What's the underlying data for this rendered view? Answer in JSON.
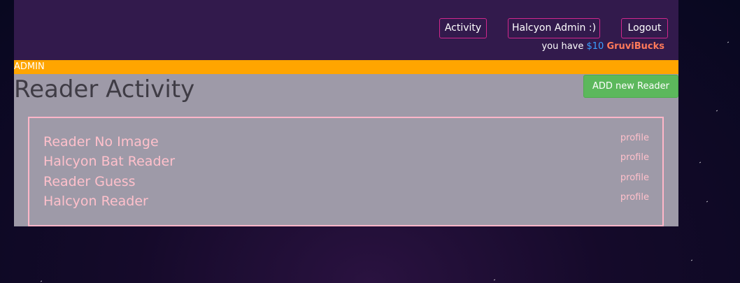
{
  "header": {
    "nav": {
      "activity_label": "Activity",
      "admin_label": "Halcyon Admin :)",
      "logout_label": "Logout"
    },
    "bucks": {
      "prefix": "you have ",
      "amount": "$10",
      "currency": "GruviBucks"
    }
  },
  "role_bar": {
    "label": "ADMIN"
  },
  "main": {
    "title": "Reader Activity",
    "add_button_label": "ADD new Reader",
    "readers": [
      {
        "name": "Reader No Image",
        "link": "profile"
      },
      {
        "name": "Halcyon Bat Reader",
        "link": "profile"
      },
      {
        "name": "Reader Guess",
        "link": "profile"
      },
      {
        "name": "Halcyon Reader",
        "link": "profile"
      }
    ]
  },
  "colors": {
    "header_bg": "#321a4c",
    "nav_border": "#d1278d",
    "admin_bar": "#ffa500",
    "content_bg": "#9e9aa8",
    "add_button": "#5cb85c",
    "reader_text": "#ffc0cb",
    "bucks_amount": "#3aa0ff",
    "bucks_name": "#ff7a5a"
  }
}
